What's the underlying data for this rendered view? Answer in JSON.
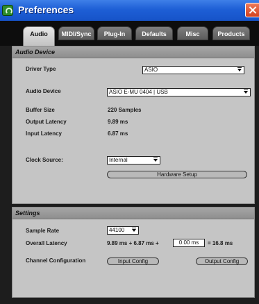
{
  "window": {
    "title": "Preferences"
  },
  "tabs": [
    {
      "label": "Audio",
      "active": true
    },
    {
      "label": "MIDI/Sync",
      "active": false
    },
    {
      "label": "Plug-In",
      "active": false
    },
    {
      "label": "Defaults",
      "active": false
    },
    {
      "label": "Misc",
      "active": false
    },
    {
      "label": "Products",
      "active": false
    }
  ],
  "audio_device": {
    "heading": "Audio Device",
    "driver_type": {
      "label": "Driver Type",
      "value": "ASIO"
    },
    "audio_device": {
      "label": "Audio Device",
      "value": "ASIO E-MU 0404 | USB"
    },
    "buffer_size": {
      "label": "Buffer Size",
      "value": "220 Samples"
    },
    "output_latency": {
      "label": "Output Latency",
      "value": "9.89 ms"
    },
    "input_latency": {
      "label": "Input Latency",
      "value": "6.87 ms"
    },
    "clock_source": {
      "label": "Clock Source:",
      "value": "Internal"
    },
    "hardware_setup_label": "Hardware Setup"
  },
  "settings": {
    "heading": "Settings",
    "sample_rate": {
      "label": "Sample Rate",
      "value": "44100"
    },
    "overall_latency": {
      "label": "Overall Latency",
      "prefix": "9.89 ms + 6.87 ms +",
      "extra_value": "0.00 ms",
      "suffix": "= 16.8 ms"
    },
    "channel_configuration": {
      "label": "Channel Configuration",
      "input_button": "Input Config",
      "output_button": "Output Config"
    }
  },
  "colors": {
    "titlebar": "#1e5fd6",
    "panel": "#c5c5c5",
    "frame": "#1d1d1d"
  },
  "icons": [
    "app-icon",
    "close-icon",
    "dropdown-arrow-icon"
  ]
}
